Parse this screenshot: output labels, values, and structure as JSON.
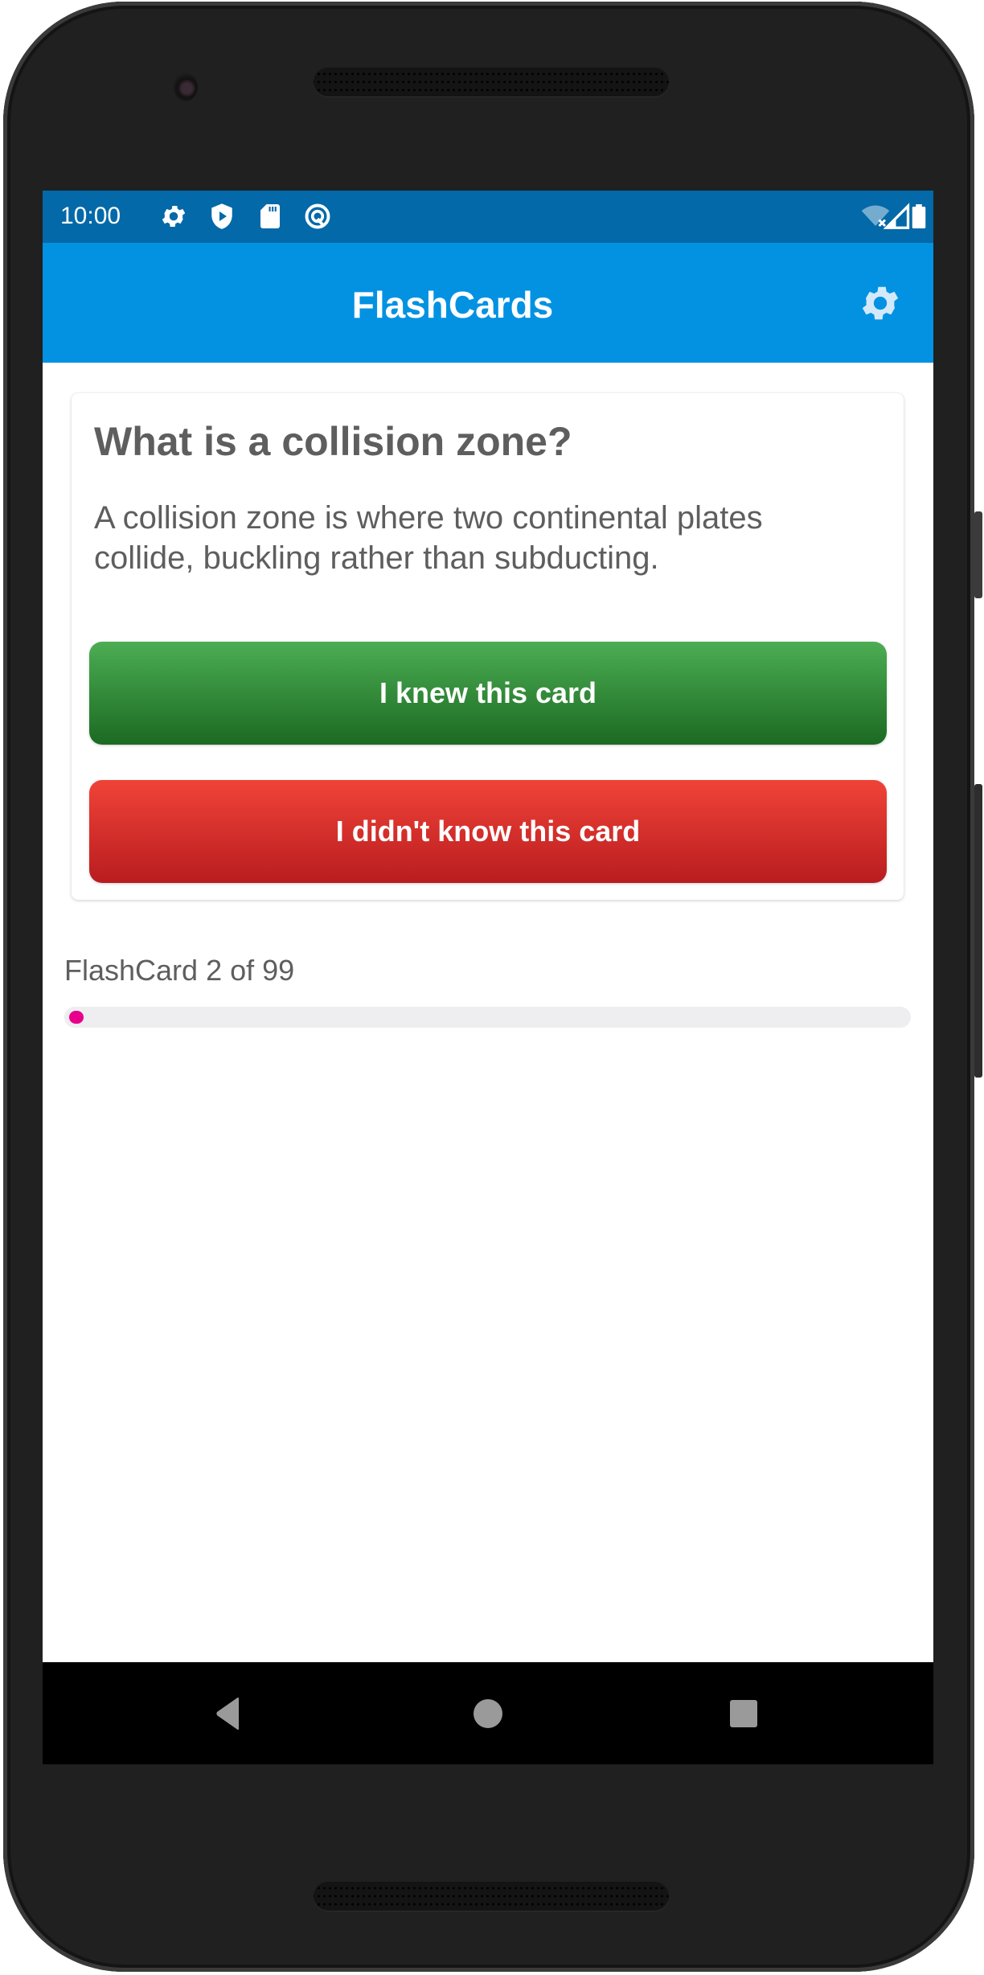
{
  "status_bar": {
    "time": "10:00",
    "left_icons": [
      "settings-gear-icon",
      "shield-play-icon",
      "sd-card-icon",
      "q-logo-icon"
    ],
    "right_icons": [
      "wifi-off-icon",
      "cellular-signal-icon",
      "battery-icon"
    ]
  },
  "app_bar": {
    "title": "FlashCards",
    "settings_icon": "gear-icon"
  },
  "card": {
    "question": "What is a collision zone?",
    "answer": "A collision zone is where two continental plates collide, buckling rather than subducting.",
    "knew_button_label": "I knew this card",
    "didnt_know_button_label": "I didn't know this card"
  },
  "progress": {
    "label": "FlashCard 2 of 99",
    "current": 2,
    "total": 99,
    "fill_color": "#e8008c"
  },
  "nav_bar": {
    "buttons": [
      "back",
      "home",
      "recents"
    ]
  },
  "colors": {
    "status_bar": "#0369a8",
    "app_bar": "#0392e2",
    "knew_button": "#2e8b36",
    "didnt_button": "#d72c2a"
  }
}
